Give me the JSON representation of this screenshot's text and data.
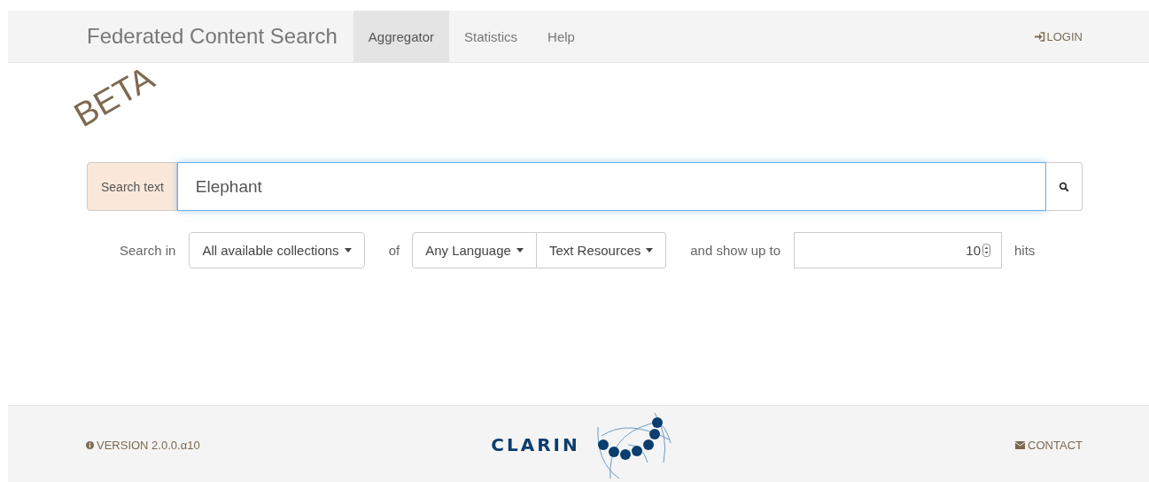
{
  "navbar": {
    "brand": "Federated Content Search",
    "tabs": [
      {
        "label": "Aggregator",
        "selected": true
      },
      {
        "label": "Statistics",
        "selected": false
      },
      {
        "label": "Help",
        "selected": false
      }
    ],
    "login": "LOGIN"
  },
  "beta": "BETA",
  "search": {
    "label": "Search text",
    "value": "Elephant"
  },
  "options": {
    "search_in": "Search in",
    "collections": "All available collections",
    "of": "of",
    "language": "Any Language",
    "resources": "Text Resources",
    "show_up_to": "and show up to",
    "max_hits": "10",
    "hits": "hits"
  },
  "footer": {
    "version": "VERSION 2.0.0.α10",
    "logo": "CLARIN",
    "contact": "CONTACT"
  }
}
